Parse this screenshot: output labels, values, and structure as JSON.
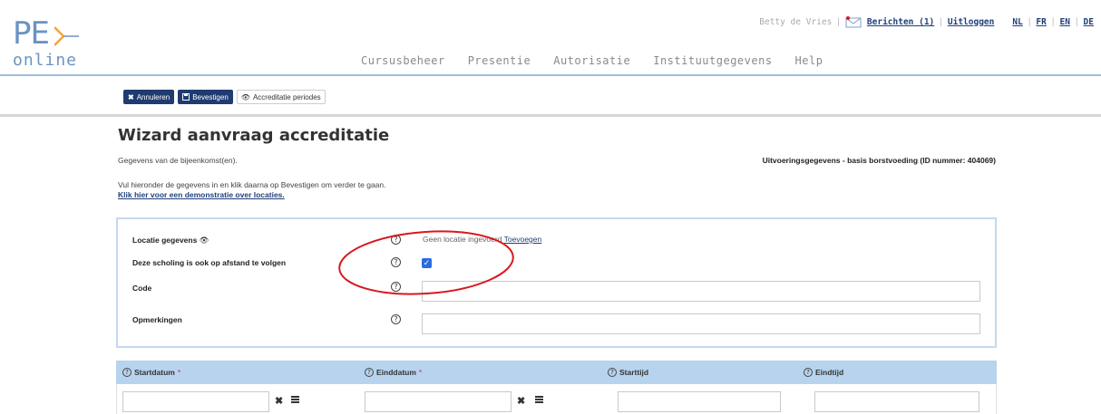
{
  "logo": {
    "pe": "PE",
    "online": "online"
  },
  "topbar": {
    "user": "Betty de Vries",
    "messages": "Berichten (1)",
    "logout": "Uitloggen",
    "languages": [
      "NL",
      "FR",
      "EN",
      "DE"
    ]
  },
  "nav": [
    "Cursusbeheer",
    "Presentie",
    "Autorisatie",
    "Instituutgegevens",
    "Help"
  ],
  "toolbar": {
    "cancel": "Annuleren",
    "confirm": "Bevestigen",
    "periods": "Accreditatie periodes"
  },
  "page": {
    "title": "Wizard aanvraag accreditatie",
    "subtitle": "Gegevens van de bijeenkomst(en).",
    "right_info": "Uitvoeringsgegevens - basis borstvoeding (ID nummer: 404069)",
    "instruction": "Vul hieronder de gegevens in en klik daarna op Bevestigen om verder te gaan.",
    "demo_link": "Klik hier voor een demonstratie over locaties."
  },
  "form": {
    "location_label": "Locatie gegevens",
    "location_value": "Geen locatie ingevoerd",
    "location_add": "Toevoegen",
    "remote_label": "Deze scholing is ook op afstand te volgen",
    "remote_checked": true,
    "code_label": "Code",
    "code_value": "",
    "remarks_label": "Opmerkingen",
    "remarks_value": ""
  },
  "dates_table": {
    "headers": [
      "Startdatum",
      "Einddatum",
      "Starttijd",
      "Eindtijd"
    ],
    "required": [
      true,
      true,
      false,
      false
    ],
    "required_mark": "*"
  },
  "colors": {
    "brand": "#1f3b70",
    "header_line": "#9ebfdf",
    "table_header": "#b7d3ee",
    "annotation": "#d8181e"
  }
}
